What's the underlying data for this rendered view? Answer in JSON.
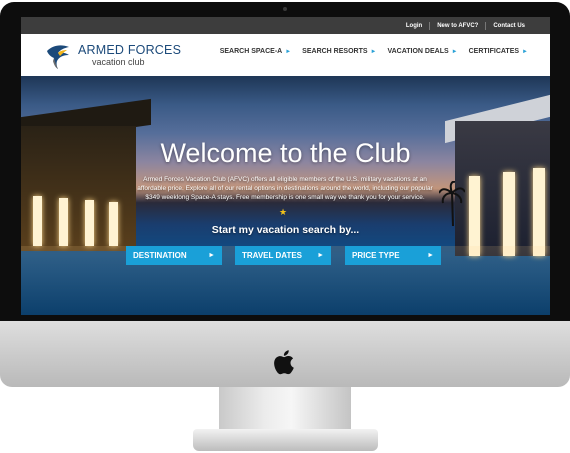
{
  "topbar": {
    "links": [
      "Login",
      "New to AFVC?",
      "Contact Us"
    ]
  },
  "logo": {
    "line1": "ARMED FORCES",
    "line2": "vacation club"
  },
  "nav": {
    "items": [
      {
        "label": "SEARCH SPACE-A",
        "arrow": "►"
      },
      {
        "label": "SEARCH RESORTS",
        "arrow": "►"
      },
      {
        "label": "VACATION DEALS",
        "arrow": "►"
      },
      {
        "label": "CERTIFICATES",
        "arrow": "►"
      }
    ]
  },
  "hero": {
    "title": "Welcome to the Club",
    "description": "Armed Forces Vacation Club (AFVC) offers all eligible members of the U.S. military vacations at an affordable price. Explore all of our rental options in destinations around the world, including our popular $349 weeklong Space-A stays. Free membership is one small way we thank you for your service.",
    "star": "★",
    "search_heading": "Start my vacation search by...",
    "buttons": [
      {
        "label": "DESTINATION",
        "arrow": "►"
      },
      {
        "label": "TRAVEL DATES",
        "arrow": "►"
      },
      {
        "label": "PRICE TYPE",
        "arrow": "►"
      }
    ]
  },
  "colors": {
    "accent": "#1aa0d8",
    "topbar": "#3d3d3d",
    "star": "#f2c21a",
    "logo_text": "#1c4a7a"
  },
  "icons": {
    "device_logo": "apple-icon",
    "brand_logo": "eagle-icon"
  }
}
